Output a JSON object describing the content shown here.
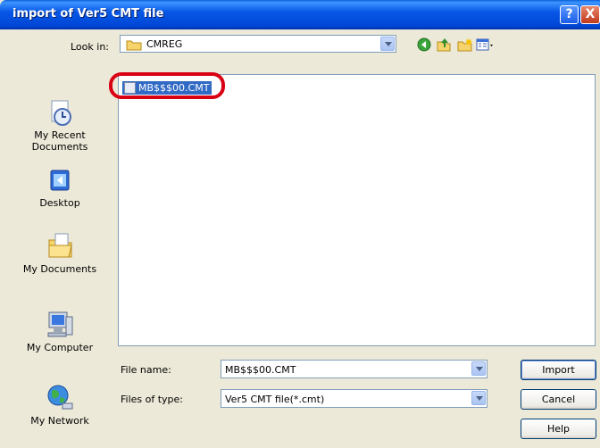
{
  "window": {
    "title": "import of Ver5 CMT file",
    "help_glyph": "?",
    "close_glyph": "X"
  },
  "lookin": {
    "label": "Look in:",
    "value": "CMREG"
  },
  "toolbar": {
    "icons": [
      "back-icon",
      "up-folder-icon",
      "new-folder-icon",
      "views-menu-icon"
    ]
  },
  "places": [
    {
      "label": "My Recent Documents",
      "icon": "recent-documents-icon"
    },
    {
      "label": "Desktop",
      "icon": "desktop-icon"
    },
    {
      "label": "My Documents",
      "icon": "my-documents-icon"
    },
    {
      "label": "My Computer",
      "icon": "my-computer-icon"
    },
    {
      "label": "My Network",
      "icon": "my-network-icon"
    }
  ],
  "files": [
    {
      "name": "MB$$$00.CMT",
      "selected": true
    }
  ],
  "filename": {
    "label": "File name:",
    "value": "MB$$$00.CMT"
  },
  "filetype": {
    "label": "Files of type:",
    "value": "Ver5 CMT file(*.cmt)"
  },
  "buttons": {
    "import": "Import",
    "cancel": "Cancel",
    "help": "Help"
  },
  "colors": {
    "titlebar": "#0054e3",
    "selection": "#316ac5",
    "highlight_ring": "#d80012",
    "dialog_bg": "#ece9d8"
  }
}
